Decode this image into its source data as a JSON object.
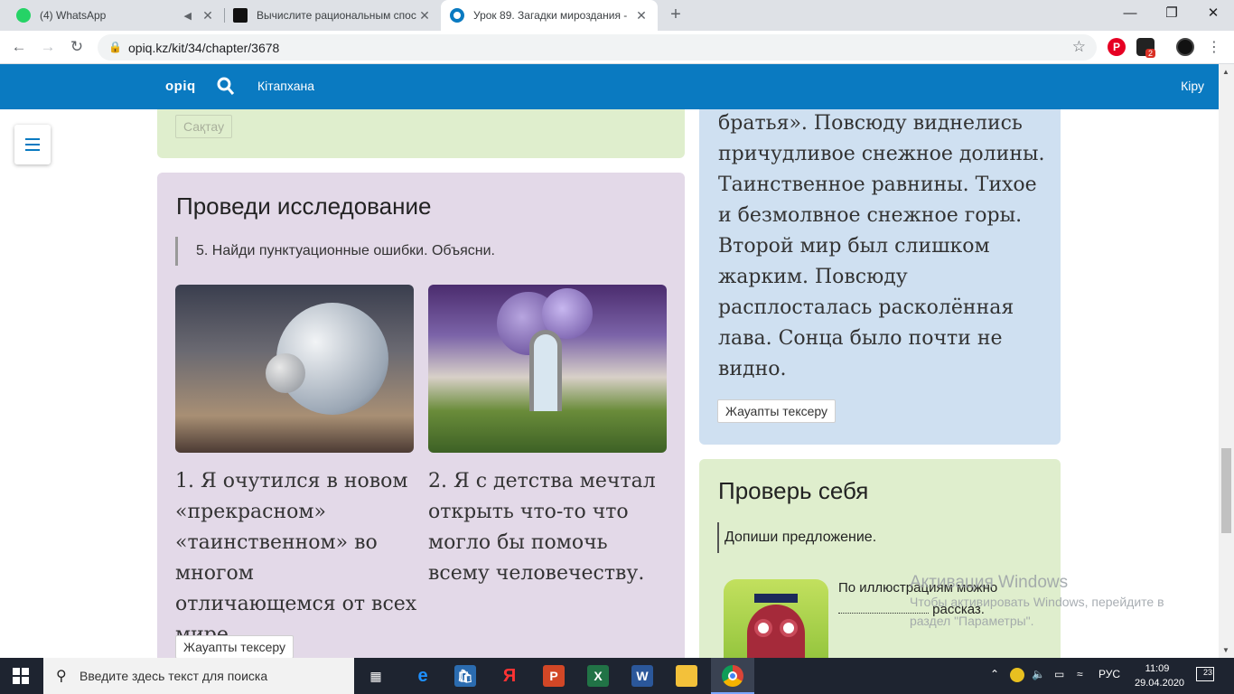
{
  "browser": {
    "tabs": [
      {
        "title": "(4) WhatsApp",
        "favicon_color": "#25d366"
      },
      {
        "title": "Вычислите рациональным спос",
        "favicon_color": "#111111"
      },
      {
        "title": "Урок 89. Загадки мироздания -",
        "favicon_color": "#0a7ac1"
      }
    ],
    "url": "opiq.kz/kit/34/chapter/3678",
    "pinterest_glyph": "P",
    "extension_badge": "2"
  },
  "site": {
    "logo": "opiq",
    "nav_library": "Кітапхана",
    "nav_login": "Кіру",
    "accent_color": "#0a7ac1"
  },
  "top_card": {
    "save_button": "Сақтау"
  },
  "research_card": {
    "heading": "Проведи исследование",
    "task": "5. Найди пунктуационные ошибки. Объясни.",
    "sentence_1": "1. Я очутился в новом «прекрасном» «таинственном» во многом отличающемся от всех мире.",
    "sentence_2": "2. Я с детства мечтал открыть что-то что могло бы помочь всему человечеству.",
    "check_button": "Жауапты тексеру"
  },
  "text_card": {
    "text": "братья». Повсюду виднелись причудливое снежное долины. Таинственное равнины. Тихое и безмолвное снежное горы. Второй мир был слишком жарким. Повсюду расплосталась расколённая лава. Сонца было почти не видно.",
    "check_button": "Жауапты тексеру"
  },
  "self_check_card": {
    "heading": "Проверь себя",
    "task": "Допиши предложение.",
    "prompt_start": "По иллюстрациям можно",
    "prompt_end": "рассказ."
  },
  "watermark": {
    "line1": "Активация Windows",
    "line2": "Чтобы активировать Windows, перейдите в раздел \"Параметры\"."
  },
  "taskbar": {
    "search_placeholder": "Введите здесь текст для поиска",
    "apps": [
      "task-view",
      "edge",
      "store",
      "yandex",
      "powerpoint",
      "excel",
      "word",
      "explorer",
      "chrome"
    ],
    "yandex_glyph": "Я",
    "language": "РУС",
    "time": "11:09",
    "date": "29.04.2020",
    "notifications": "23"
  }
}
